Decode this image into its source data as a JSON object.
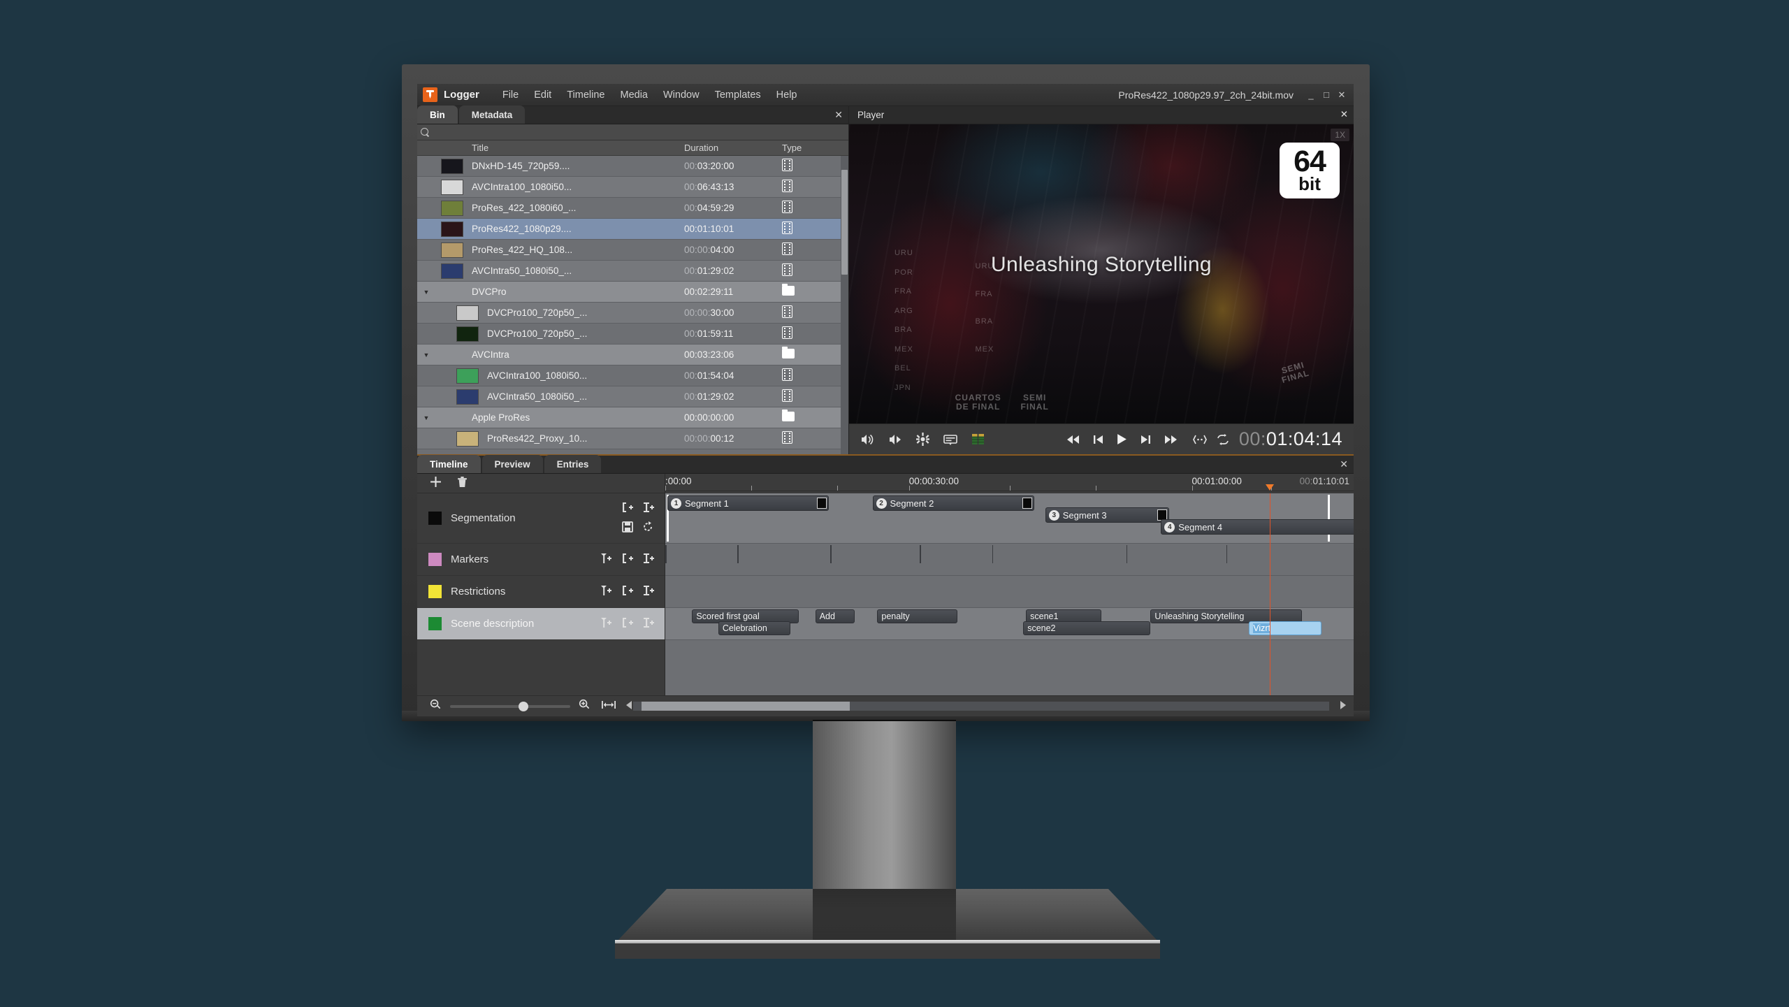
{
  "app": {
    "name": "Logger",
    "document_title": "ProRes422_1080p29.97_2ch_24bit.mov",
    "menu": [
      "File",
      "Edit",
      "Timeline",
      "Media",
      "Window",
      "Templates",
      "Help"
    ],
    "window_buttons": {
      "minimize": "_",
      "maximize": "□",
      "close": "✕"
    },
    "accent_color": "#e8631a"
  },
  "bin": {
    "tabs": [
      {
        "label": "Bin",
        "active": true
      },
      {
        "label": "Metadata",
        "active": false
      }
    ],
    "close_label": "✕",
    "search": {
      "value": "",
      "placeholder": ""
    },
    "columns": [
      "Title",
      "Duration",
      "Type"
    ],
    "rows": [
      {
        "title": "DNxHD-145_720p59....",
        "duration_dim": "00:",
        "duration": "03:20:00",
        "type": "clip",
        "indent": 0,
        "selected": false,
        "folder": false,
        "thumb": "#16161c"
      },
      {
        "title": "AVCIntra100_1080i50...",
        "duration_dim": "00:",
        "duration": "06:43:13",
        "type": "clip",
        "indent": 0,
        "selected": false,
        "folder": false,
        "thumb": "#d8d8d8"
      },
      {
        "title": "ProRes_422_1080i60_...",
        "duration_dim": "00:",
        "duration": "04:59:29",
        "type": "clip",
        "indent": 0,
        "selected": false,
        "folder": false,
        "thumb": "#6f7f3a"
      },
      {
        "title": "ProRes422_1080p29....",
        "duration_dim": "",
        "duration": "00:01:10:01",
        "type": "clip",
        "indent": 0,
        "selected": true,
        "folder": false,
        "thumb": "#2a1418"
      },
      {
        "title": "ProRes_422_HQ_108...",
        "duration_dim": "00:00:",
        "duration": "04:00",
        "type": "clip",
        "indent": 0,
        "selected": false,
        "folder": false,
        "thumb": "#b49a6a"
      },
      {
        "title": "AVCIntra50_1080i50_...",
        "duration_dim": "00:",
        "duration": "01:29:02",
        "type": "clip",
        "indent": 0,
        "selected": false,
        "folder": false,
        "thumb": "#2b3c6e"
      },
      {
        "title": "DVCPro",
        "duration_dim": "",
        "duration": "00:02:29:11",
        "type": "folder",
        "indent": 0,
        "selected": false,
        "folder": true,
        "thumb": ""
      },
      {
        "title": "DVCPro100_720p50_...",
        "duration_dim": "00:00:",
        "duration": "30:00",
        "type": "clip",
        "indent": 1,
        "selected": false,
        "folder": false,
        "thumb": "#c9c9c9"
      },
      {
        "title": "DVCPro100_720p50_...",
        "duration_dim": "00:",
        "duration": "01:59:11",
        "type": "clip",
        "indent": 1,
        "selected": false,
        "folder": false,
        "thumb": "#11240f"
      },
      {
        "title": "AVCIntra",
        "duration_dim": "",
        "duration": "00:03:23:06",
        "type": "folder",
        "indent": 0,
        "selected": false,
        "folder": true,
        "thumb": ""
      },
      {
        "title": "AVCIntra100_1080i50...",
        "duration_dim": "00:",
        "duration": "01:54:04",
        "type": "clip",
        "indent": 1,
        "selected": false,
        "folder": false,
        "thumb": "#3da05a"
      },
      {
        "title": "AVCIntra50_1080i50_...",
        "duration_dim": "00:",
        "duration": "01:29:02",
        "type": "clip",
        "indent": 1,
        "selected": false,
        "folder": false,
        "thumb": "#2b3c6e"
      },
      {
        "title": "Apple ProRes",
        "duration_dim": "",
        "duration": "00:00:00:00",
        "type": "folder",
        "indent": 0,
        "selected": false,
        "folder": true,
        "thumb": ""
      },
      {
        "title": "ProRes422_Proxy_10...",
        "duration_dim": "00:00:",
        "duration": "00:12",
        "type": "clip",
        "indent": 1,
        "selected": false,
        "folder": false,
        "thumb": "#c8b27a"
      }
    ]
  },
  "player": {
    "title": "Player",
    "close_label": "✕",
    "speed_indicator": "1X",
    "badge": {
      "number": "64",
      "unit": "bit"
    },
    "overlay_title": "Unleashing Storytelling",
    "video_text": {
      "left_column": [
        "URU",
        "POR",
        "FRA",
        "ARG",
        "BRA",
        "MEX",
        "BEL",
        "JPN"
      ],
      "mid_column": [
        "URU",
        "FRA",
        "BRA",
        "MEX"
      ],
      "bracket_labels": [
        "CUARTOS DE FINAL",
        "SEMI FINAL",
        "SEMI FINAL"
      ]
    },
    "transport_icons_left": [
      "audio-icon",
      "audio-follow-icon",
      "settings-icon",
      "subtitle-icon",
      "levels-icon"
    ],
    "transport_icons_mid": [
      "rewind-icon",
      "prev-frame-icon",
      "play-icon",
      "next-frame-icon",
      "fast-forward-icon"
    ],
    "transport_icons_right": [
      "in-out-icon",
      "loop-icon"
    ],
    "timecode": {
      "dim": "00:",
      "value": "01:04:14"
    }
  },
  "timeline": {
    "tabs": [
      {
        "label": "Timeline",
        "active": true
      },
      {
        "label": "Preview",
        "active": false
      },
      {
        "label": "Entries",
        "active": false
      }
    ],
    "close_label": "✕",
    "toolbar": [
      "add-icon",
      "delete-icon"
    ],
    "ruler": {
      "labels": [
        {
          "text": ":00:00",
          "pos_pct": 0.0
        },
        {
          "text": "00:00:30:00",
          "pos_pct": 35.4
        },
        {
          "text": "00:01:00:00",
          "pos_pct": 76.5
        }
      ],
      "duration_dim": "00:",
      "duration": "01:10:01",
      "playhead_pct": 87.8
    },
    "tracks": [
      {
        "name": "Segmentation",
        "color": "#0a0a0a",
        "selected": false,
        "icons": [
          "mark-in-icon",
          "mark-out-icon",
          "save-icon",
          "refresh-icon"
        ]
      },
      {
        "name": "Markers",
        "color": "#cd8ac0",
        "selected": false,
        "icons": [
          "add-marker-icon",
          "mark-in-icon",
          "mark-out-icon"
        ]
      },
      {
        "name": "Restrictions",
        "color": "#f2e436",
        "selected": false,
        "icons": [
          "add-marker-icon",
          "mark-in-icon",
          "mark-out-icon"
        ]
      },
      {
        "name": "Scene description",
        "color": "#1c8a33",
        "selected": true,
        "icons": [
          "add-marker-icon",
          "mark-in-icon",
          "mark-out-icon"
        ]
      }
    ],
    "segments": [
      {
        "num": "1",
        "label": "Segment 1",
        "left_pct": 0.0,
        "width_pct": 23.5,
        "lane": 0
      },
      {
        "num": "2",
        "label": "Segment 2",
        "left_pct": 29.8,
        "width_pct": 23.5,
        "lane": 0
      },
      {
        "num": "3",
        "label": "Segment 3",
        "left_pct": 54.9,
        "width_pct": 18.0,
        "lane": 1
      },
      {
        "num": "4",
        "label": "Segment 4",
        "left_pct": 71.7,
        "width_pct": 28.3,
        "lane": 2
      }
    ],
    "marker_ticks_pct": [
      0.0,
      10.5,
      24.0,
      37.0,
      47.5,
      67.0,
      81.5
    ],
    "scene_entries": [
      {
        "text": "Scored first goal",
        "left_pct": 3.9,
        "width_pct": 15.5,
        "lane": 0,
        "editing": false
      },
      {
        "text": "Celebration",
        "left_pct": 7.7,
        "width_pct": 10.5,
        "lane": 1,
        "editing": false
      },
      {
        "text": "Add",
        "left_pct": 21.8,
        "width_pct": 5.7,
        "lane": 0,
        "editing": false
      },
      {
        "text": "penalty",
        "left_pct": 30.8,
        "width_pct": 11.6,
        "lane": 0,
        "editing": false
      },
      {
        "text": "scene1",
        "left_pct": 52.4,
        "width_pct": 11.0,
        "lane": 0,
        "editing": false
      },
      {
        "text": "scene2",
        "left_pct": 52.0,
        "width_pct": 18.5,
        "lane": 1,
        "editing": false
      },
      {
        "text": "Unleashing Storytelling",
        "left_pct": 70.5,
        "width_pct": 22.0,
        "lane": 0,
        "editing": false
      },
      {
        "text": "Vizrt",
        "left_pct": 84.8,
        "width_pct": 10.5,
        "lane": 1,
        "editing": true
      }
    ],
    "footer": {
      "zoom_out_icon": "zoom-out-icon",
      "zoom_in_icon": "zoom-in-icon",
      "fit_icon": "fit-to-width-icon",
      "scroll_left_icon": "scroll-left-icon",
      "scroll_right_icon": "scroll-right-icon",
      "zoom_value_pct": 57
    }
  }
}
